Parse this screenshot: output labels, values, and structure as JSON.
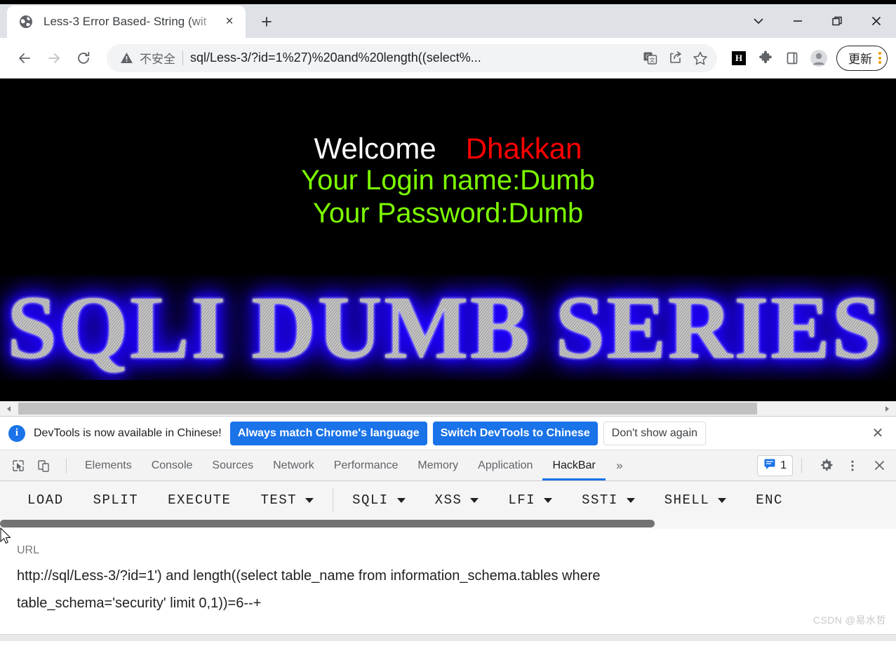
{
  "browser": {
    "tab": {
      "title": "Less-3 Error Based- String (wit",
      "favicon_name": "globe-icon",
      "close_label": "×",
      "new_tab_label": "+"
    },
    "window_controls": {
      "tab_search_label": "⌄",
      "minimize_label": "—",
      "maximize_label": "❐",
      "close_label": "✕"
    },
    "toolbar": {
      "back_label": "←",
      "forward_label": "→",
      "reload_label": "⟳",
      "security_text": "不安全",
      "url_display": "sql/Less-3/?id=1%27)%20and%20length((select%...",
      "url_bold_part": "sql",
      "translate_icon": "translate-icon",
      "share_icon": "share-icon",
      "bookmark_icon": "star-icon",
      "extension_h_label": "H",
      "extensions_icon": "puzzle-icon",
      "side_panel_icon": "side-panel-icon",
      "profile_icon": "avatar-icon",
      "update_label": "更新"
    }
  },
  "page": {
    "welcome": "Welcome",
    "username_highlight": "Dhakkan",
    "login_name_line": "Your Login name:Dumb",
    "password_line": "Your Password:Dumb",
    "logo_text": "SQLI DUMB SERIES",
    "colors": {
      "background": "#000000",
      "welcome": "#ffffff",
      "highlight": "#ff0000",
      "credentials": "#7cfc00",
      "logo_glow": "#1a00ff",
      "logo_fill": "#b9b9b9"
    }
  },
  "devtools": {
    "banner": {
      "message": "DevTools is now available in Chinese!",
      "primary_button": "Always match Chrome's language",
      "secondary_button": "Switch DevTools to Chinese",
      "tertiary_button": "Don't show again",
      "close_label": "✕",
      "info_icon": "info-icon"
    },
    "tools": {
      "inspect_icon": "inspect-element-icon",
      "device_toggle_icon": "device-toolbar-icon"
    },
    "tabs": [
      {
        "label": "Elements",
        "active": false
      },
      {
        "label": "Console",
        "active": false
      },
      {
        "label": "Sources",
        "active": false
      },
      {
        "label": "Network",
        "active": false
      },
      {
        "label": "Performance",
        "active": false
      },
      {
        "label": "Memory",
        "active": false
      },
      {
        "label": "Application",
        "active": false
      },
      {
        "label": "HackBar",
        "active": true
      }
    ],
    "more_tabs_label": "»",
    "message_count": "1",
    "message_icon": "message-icon",
    "settings_icon": "gear-icon",
    "kebab_icon": "kebab-menu-icon",
    "close_icon": "close-icon"
  },
  "hackbar": {
    "buttons": [
      {
        "label": "LOAD",
        "caret": false
      },
      {
        "label": "SPLIT",
        "caret": false
      },
      {
        "label": "EXECUTE",
        "caret": false
      },
      {
        "label": "TEST",
        "caret": true
      }
    ],
    "payload_menus": [
      {
        "label": "SQLI",
        "caret": true
      },
      {
        "label": "XSS",
        "caret": true
      },
      {
        "label": "LFI",
        "caret": true
      },
      {
        "label": "SSTI",
        "caret": true
      },
      {
        "label": "SHELL",
        "caret": true
      },
      {
        "label": "ENC",
        "caret": false
      }
    ],
    "url_field": {
      "label": "URL",
      "value": "http://sql/Less-3/?id=1') and length((select table_name from information_schema.tables where table_schema='security' limit 0,1))=6--+"
    }
  },
  "watermark": "CSDN @易水哲"
}
